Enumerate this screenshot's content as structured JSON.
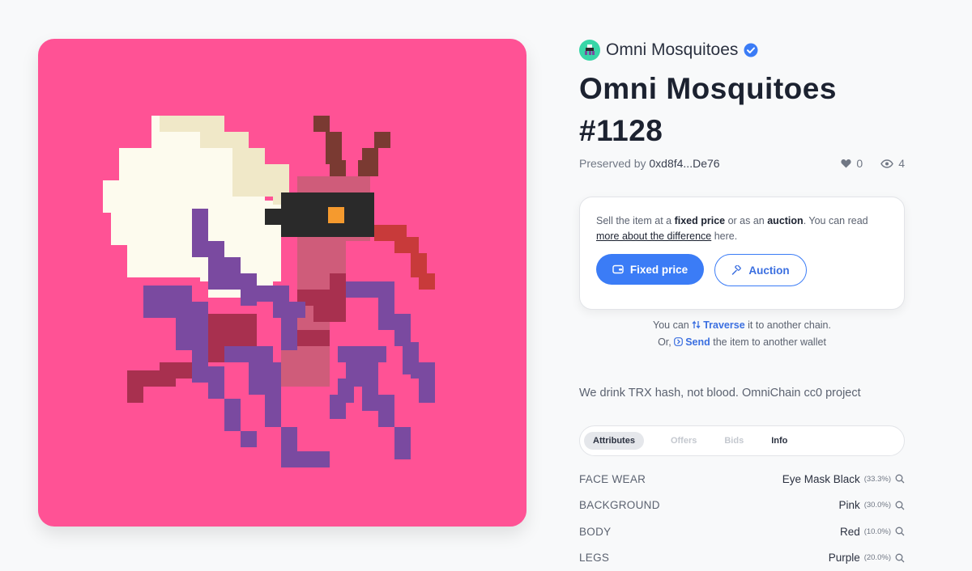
{
  "nft": {
    "collection_name": "Omni Mosquitoes",
    "title": "Omni Mosquitoes #1128",
    "owner_label": "Preserved by",
    "owner_address": "0xd8f4...De76",
    "likes": "0",
    "views": "4",
    "description": "We drink TRX hash, not blood. OmniChain cc0 project"
  },
  "sale": {
    "t1": "Sell the item at a ",
    "b1": "fixed price",
    "t2": " or as an ",
    "b2": "auction",
    "t3": ". You can read ",
    "link": "more about the difference",
    "t4": " here.",
    "fixed_label": "Fixed price",
    "auction_label": "Auction"
  },
  "chain": {
    "pre1": "You can ",
    "traverse": "Traverse",
    "post1": " it to another chain.",
    "pre2": "Or, ",
    "send": "Send",
    "post2": " the item to another wallet"
  },
  "tabs": [
    "Attributes",
    "Offers",
    "Bids",
    "Info"
  ],
  "attributes": [
    {
      "key": "FACE WEAR",
      "value": "Eye Mask Black",
      "pct": "(33.3%)"
    },
    {
      "key": "BACKGROUND",
      "value": "Pink",
      "pct": "(30.0%)"
    },
    {
      "key": "BODY",
      "value": "Red",
      "pct": "(10.0%)"
    },
    {
      "key": "LEGS",
      "value": "Purple",
      "pct": "(20.0%)"
    }
  ],
  "colors": {
    "accent": "#3b7cf6",
    "background_art": "#ff5295",
    "wing": "#fdfbee",
    "wing_shade": "#f0e8c8",
    "body": "#cf5c7a",
    "body_dark": "#a8304f",
    "legs": "#7a4aa0",
    "antenna": "#7a3a32",
    "mask": "#2a2a2a",
    "eye": "#f59a2e",
    "proboscis": "#c83a3a"
  }
}
